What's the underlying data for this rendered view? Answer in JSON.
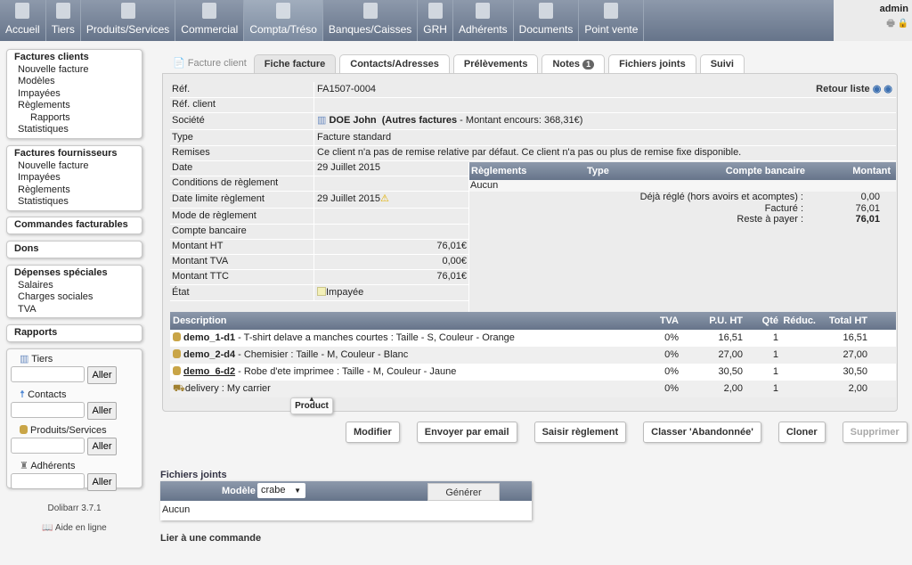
{
  "menu": [
    {
      "label": "Accueil",
      "icon": "home-icon"
    },
    {
      "label": "Tiers",
      "icon": "building-icon"
    },
    {
      "label": "Produits/Services",
      "icon": "boxes-icon"
    },
    {
      "label": "Commercial",
      "icon": "tie-icon"
    },
    {
      "label": "Compta/Tréso",
      "icon": "coins-icon",
      "active": true
    },
    {
      "label": "Banques/Caisses",
      "icon": "safe-icon"
    },
    {
      "label": "GRH",
      "icon": "beach-icon"
    },
    {
      "label": "Adhérents",
      "icon": "members-icon"
    },
    {
      "label": "Documents",
      "icon": "folder-icon"
    },
    {
      "label": "Point vente",
      "icon": "cash-register-icon"
    }
  ],
  "user": "admin",
  "sidebar": {
    "clients": {
      "title": "Factures clients",
      "items": [
        "Nouvelle facture",
        "Modèles",
        "Impayées",
        "Règlements",
        "Rapports",
        "Statistiques"
      ]
    },
    "fournisseurs": {
      "title": "Factures fournisseurs",
      "items": [
        "Nouvelle facture",
        "Impayées",
        "Règlements",
        "Statistiques"
      ]
    },
    "commandes": "Commandes facturables",
    "dons": "Dons",
    "depenses": {
      "title": "Dépenses spéciales",
      "items": [
        "Salaires",
        "Charges sociales",
        "TVA"
      ]
    },
    "rapports": "Rapports",
    "search": [
      {
        "label": "Tiers"
      },
      {
        "label": "Contacts"
      },
      {
        "label": "Produits/Services"
      },
      {
        "label": "Adhérents"
      }
    ],
    "go": "Aller",
    "version": "Dolibarr 3.7.1",
    "help": "Aide en ligne"
  },
  "tabs": [
    "Facture client",
    "Fiche facture",
    "Contacts/Adresses",
    "Prélèvements",
    "Notes",
    "Fichiers joints",
    "Suivi"
  ],
  "notes_count": "1",
  "card": {
    "ref_label": "Réf.",
    "ref": "FA1507-0004",
    "back": "Retour liste",
    "refclient_label": "Réf. client",
    "societe_label": "Société",
    "societe": "DOE John",
    "autres": "(Autres factures",
    "encours": " - Montant encours: 368,31€)",
    "type_label": "Type",
    "type": "Facture standard",
    "remises_label": "Remises",
    "remises": "Ce client n'a pas de remise relative par défaut. Ce client n'a pas ou plus de remise fixe disponible.",
    "date_label": "Date",
    "date": "29 Juillet 2015",
    "cond_label": "Conditions de règlement",
    "datelim_label": "Date limite règlement",
    "datelim": "29 Juillet 2015",
    "mode_label": "Mode de règlement",
    "compte_label": "Compte bancaire",
    "ht_label": "Montant HT",
    "ht": "76,01€",
    "tva_label": "Montant TVA",
    "tva": "0,00€",
    "ttc_label": "Montant TTC",
    "ttc": "76,01€",
    "etat_label": "État",
    "etat": "Impayée"
  },
  "payments": {
    "headers": [
      "Règlements",
      "Type",
      "Compte bancaire",
      "Montant"
    ],
    "none": "Aucun",
    "deja_label": "Déjà réglé (hors avoirs et acomptes) :",
    "deja": "0,00",
    "facture_label": "Facturé :",
    "facture": "76,01",
    "reste_label": "Reste à payer :",
    "reste": "76,01"
  },
  "lines": {
    "headers": [
      "Description",
      "TVA",
      "P.U. HT",
      "Qté",
      "Réduc.",
      "Total HT"
    ],
    "rows": [
      {
        "ref": "demo_1-d1",
        "desc": " - T-shirt delave a manches courtes : Taille - S, Couleur - Orange",
        "tva": "0%",
        "pu": "16,51",
        "qty": "1",
        "total": "16,51"
      },
      {
        "ref": "demo_2-d4",
        "desc": " - Chemisier : Taille - M, Couleur - Blanc",
        "tva": "0%",
        "pu": "27,00",
        "qty": "1",
        "total": "27,00"
      },
      {
        "ref": "demo_6-d2",
        "desc": " - Robe d'ete imprimee : Taille - M, Couleur - Jaune",
        "tva": "0%",
        "pu": "30,50",
        "qty": "1",
        "total": "30,50"
      },
      {
        "ref": "",
        "desc": "delivery : My carrier",
        "tva": "0%",
        "pu": "2,00",
        "qty": "1",
        "total": "2,00"
      }
    ]
  },
  "tooltip": "Product",
  "buttons": [
    "Modifier",
    "Envoyer par email",
    "Saisir règlement",
    "Classer 'Abandonnée'",
    "Cloner",
    "Supprimer"
  ],
  "files": {
    "title": "Fichiers joints",
    "model_label": "Modèle",
    "model": "crabe",
    "generate": "Générer",
    "none": "Aucun"
  },
  "link_order": "Lier à une commande"
}
